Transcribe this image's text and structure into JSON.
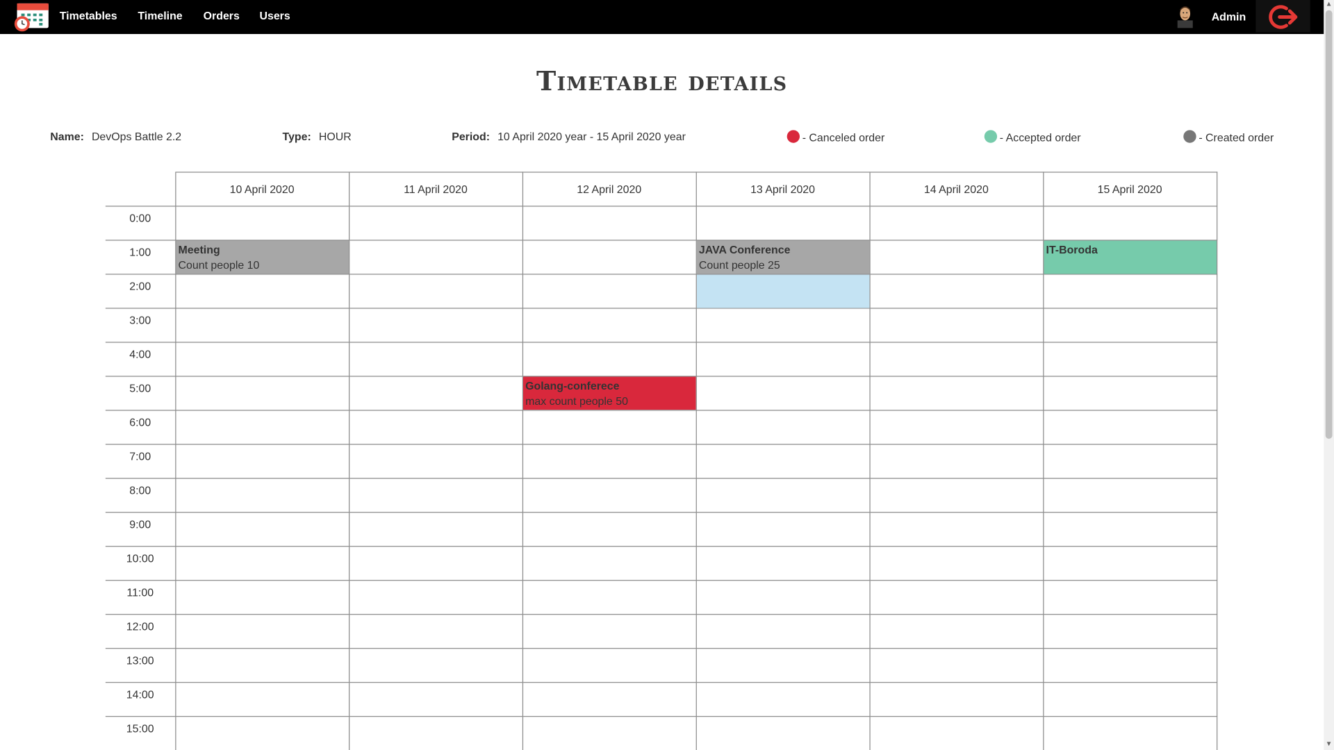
{
  "nav": {
    "links": [
      "Timetables",
      "Timeline",
      "Orders",
      "Users"
    ],
    "user": "Admin"
  },
  "page": {
    "title": "Timetable details"
  },
  "details": {
    "name_label": "Name:",
    "name_value": "DevOps Battle 2.2",
    "type_label": "Type:",
    "type_value": "HOUR",
    "period_label": "Period:",
    "period_value": "10 April 2020 year - 15 April 2020 year"
  },
  "legend": [
    {
      "label": "- Canceled order",
      "color": "#d9283c"
    },
    {
      "label": "- Accepted order",
      "color": "#76cbab"
    },
    {
      "label": "- Created order",
      "color": "#777777"
    }
  ],
  "colors": {
    "canceled": "#d9283c",
    "accepted": "#76cbab",
    "created": "#a7a7a7",
    "selected": "#c4e3f3"
  },
  "timetable": {
    "days": [
      "10 April 2020",
      "11 April 2020",
      "12 April 2020",
      "13 April 2020",
      "14 April 2020",
      "15 April 2020"
    ],
    "hours": [
      "0:00",
      "1:00",
      "2:00",
      "3:00",
      "4:00",
      "5:00",
      "6:00",
      "7:00",
      "8:00",
      "9:00",
      "10:00",
      "11:00",
      "12:00",
      "13:00",
      "14:00",
      "15:00"
    ],
    "orders": [
      {
        "day": 0,
        "hour": 1,
        "title": "Meeting",
        "subtitle": "Count people 10",
        "status": "created"
      },
      {
        "day": 3,
        "hour": 1,
        "title": "JAVA Conference",
        "subtitle": "Count people 25",
        "status": "created"
      },
      {
        "day": 5,
        "hour": 1,
        "title": "IT-Boroda",
        "subtitle": "",
        "status": "accepted"
      },
      {
        "day": 2,
        "hour": 5,
        "title": "Golang-conferece",
        "subtitle": "max count people 50",
        "status": "canceled"
      }
    ],
    "selected": [
      {
        "day": 3,
        "hour": 2
      }
    ]
  }
}
